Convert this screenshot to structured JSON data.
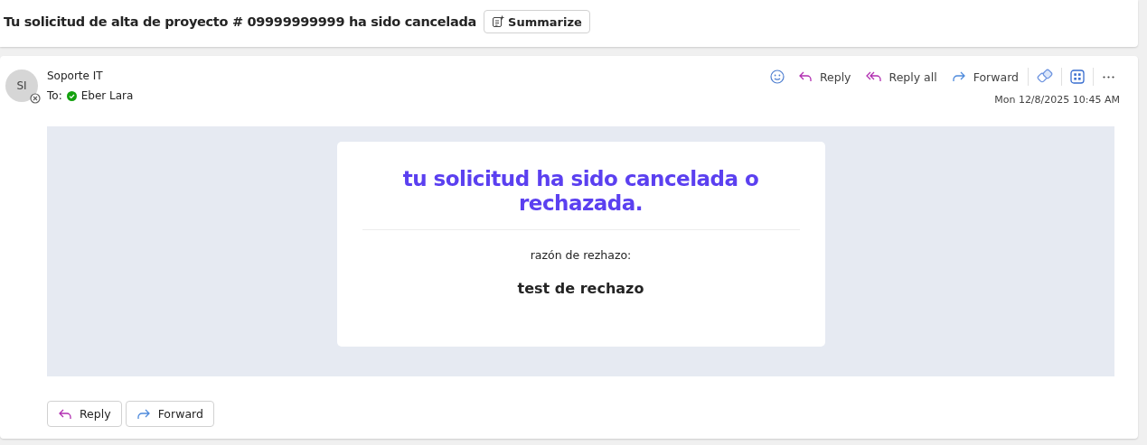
{
  "subject": "Tu solicitud de alta de proyecto # 09999999999 ha sido cancelada",
  "summarize_button": "Summarize",
  "message": {
    "avatar_initials": "SI",
    "sender": "Soporte IT",
    "to_label": "To:",
    "recipient": "Eber Lara",
    "date": "Mon 12/8/2025 10:45 AM"
  },
  "actions": [
    {
      "kind": "reply",
      "label": "Reply"
    },
    {
      "kind": "reply_all",
      "label": "Reply all"
    },
    {
      "kind": "forward",
      "label": "Forward"
    }
  ],
  "body": {
    "heading": "tu solicitud ha sido cancelada o rechazada.",
    "reason_label": "razón de rezhazo:",
    "reason": "test de rechazo"
  },
  "footer_buttons": [
    {
      "kind": "reply",
      "label": "Reply"
    },
    {
      "kind": "forward",
      "label": "Forward"
    }
  ]
}
